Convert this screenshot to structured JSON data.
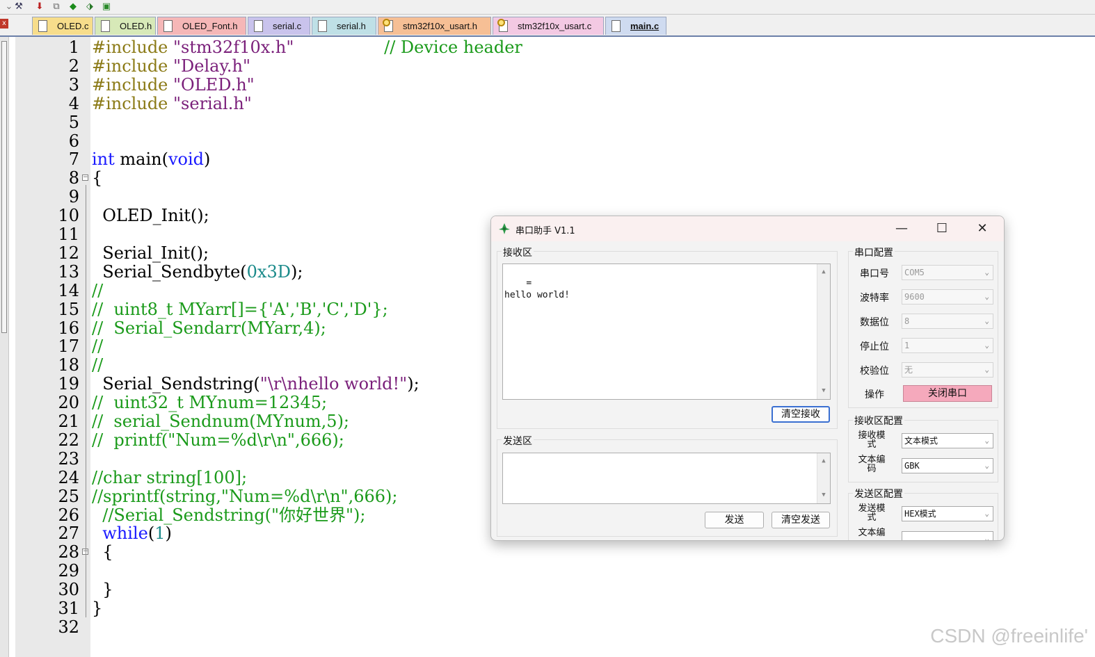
{
  "toolbar": {
    "icons": [
      "tools-icon",
      "load-icon",
      "copy-icon",
      "diamond-icon",
      "pack-icon",
      "green-box-icon"
    ]
  },
  "tabs": [
    {
      "label": "OLED.c",
      "color": "#f7dd8b",
      "icon": "file-icon"
    },
    {
      "label": "OLED.h",
      "color": "#d7e9b8",
      "icon": "file-icon"
    },
    {
      "label": "OLED_Font.h",
      "color": "#f5b7b7",
      "icon": "file-icon"
    },
    {
      "label": "serial.c",
      "color": "#c9c3ec",
      "icon": "file-icon"
    },
    {
      "label": "serial.h",
      "color": "#bfe0e6",
      "icon": "file-icon"
    },
    {
      "label": "stm32f10x_usart.h",
      "color": "#f6bf95",
      "icon": "key-file-icon"
    },
    {
      "label": "stm32f10x_usart.c",
      "color": "#f3c9e3",
      "icon": "key-file-icon"
    },
    {
      "label": "main.c",
      "color": "#cfdbf0",
      "icon": "file-icon",
      "active": true
    }
  ],
  "code_lines": [
    {
      "n": "1",
      "tokens": [
        {
          "t": "#include ",
          "c": "pp"
        },
        {
          "t": "\"stm32f10x.h\"",
          "c": "str"
        },
        {
          "t": "                 ",
          "c": ""
        },
        {
          "t": "// Device header",
          "c": "cmt"
        }
      ]
    },
    {
      "n": "2",
      "tokens": [
        {
          "t": "#include ",
          "c": "pp"
        },
        {
          "t": "\"Delay.h\"",
          "c": "str"
        }
      ]
    },
    {
      "n": "3",
      "tokens": [
        {
          "t": "#include ",
          "c": "pp"
        },
        {
          "t": "\"OLED.h\"",
          "c": "str"
        }
      ]
    },
    {
      "n": "4",
      "tokens": [
        {
          "t": "#include ",
          "c": "pp"
        },
        {
          "t": "\"serial.h\"",
          "c": "str"
        }
      ]
    },
    {
      "n": "5",
      "tokens": []
    },
    {
      "n": "6",
      "tokens": []
    },
    {
      "n": "7",
      "tokens": [
        {
          "t": "int",
          "c": "kw"
        },
        {
          "t": " main(",
          "c": ""
        },
        {
          "t": "void",
          "c": "kw"
        },
        {
          "t": ")",
          "c": ""
        }
      ]
    },
    {
      "n": "8",
      "tokens": [
        {
          "t": "{",
          "c": ""
        }
      ],
      "fold": "open"
    },
    {
      "n": "9",
      "tokens": []
    },
    {
      "n": "10",
      "tokens": [
        {
          "t": "  OLED_Init();",
          "c": ""
        }
      ]
    },
    {
      "n": "11",
      "tokens": []
    },
    {
      "n": "12",
      "tokens": [
        {
          "t": "  Serial_Init();",
          "c": ""
        }
      ]
    },
    {
      "n": "13",
      "tokens": [
        {
          "t": "  Serial_Sendbyte(",
          "c": ""
        },
        {
          "t": "0x3D",
          "c": "num"
        },
        {
          "t": ");",
          "c": ""
        }
      ]
    },
    {
      "n": "14",
      "tokens": [
        {
          "t": "//",
          "c": "cmt"
        }
      ]
    },
    {
      "n": "15",
      "tokens": [
        {
          "t": "//  uint8_t MYarr[]={'A','B','C','D'};",
          "c": "cmt"
        }
      ]
    },
    {
      "n": "16",
      "tokens": [
        {
          "t": "//  Serial_Sendarr(MYarr,4);",
          "c": "cmt"
        }
      ]
    },
    {
      "n": "17",
      "tokens": [
        {
          "t": "//",
          "c": "cmt"
        }
      ]
    },
    {
      "n": "18",
      "tokens": [
        {
          "t": "//",
          "c": "cmt"
        }
      ]
    },
    {
      "n": "19",
      "tokens": [
        {
          "t": "  Serial_Sendstring(",
          "c": ""
        },
        {
          "t": "\"\\r\\nhello world!\"",
          "c": "str"
        },
        {
          "t": ");",
          "c": ""
        }
      ]
    },
    {
      "n": "20",
      "tokens": [
        {
          "t": "//  uint32_t MYnum=12345;",
          "c": "cmt"
        }
      ]
    },
    {
      "n": "21",
      "tokens": [
        {
          "t": "//  serial_Sendnum(MYnum,5);",
          "c": "cmt"
        }
      ]
    },
    {
      "n": "22",
      "tokens": [
        {
          "t": "//  printf(\"Num=%d\\r\\n\",666);",
          "c": "cmt"
        }
      ]
    },
    {
      "n": "23",
      "tokens": []
    },
    {
      "n": "24",
      "tokens": [
        {
          "t": "//char string[100];",
          "c": "cmt"
        }
      ]
    },
    {
      "n": "25",
      "tokens": [
        {
          "t": "//sprintf(string,\"Num=%d\\r\\n\",666);",
          "c": "cmt"
        }
      ]
    },
    {
      "n": "26",
      "tokens": [
        {
          "t": "  //Serial_Sendstring(\"你好世界\");",
          "c": "cmt"
        }
      ]
    },
    {
      "n": "27",
      "tokens": [
        {
          "t": "  ",
          "c": ""
        },
        {
          "t": "while",
          "c": "kw"
        },
        {
          "t": "(",
          "c": ""
        },
        {
          "t": "1",
          "c": "num"
        },
        {
          "t": ")",
          "c": ""
        }
      ]
    },
    {
      "n": "28",
      "tokens": [
        {
          "t": "  {",
          "c": ""
        }
      ],
      "fold": "open"
    },
    {
      "n": "29",
      "tokens": []
    },
    {
      "n": "30",
      "tokens": [
        {
          "t": "  }",
          "c": ""
        }
      ]
    },
    {
      "n": "31",
      "tokens": [
        {
          "t": "}",
          "c": ""
        }
      ]
    },
    {
      "n": "32",
      "tokens": []
    }
  ],
  "watermark": "CSDN @freeinlife'",
  "dialog": {
    "title": "串口助手 V1.1",
    "minimize": "—",
    "maximize": "☐",
    "close": "✕",
    "receive": {
      "title": "接收区",
      "content": "=\nhello world!",
      "clear_button": "清空接收"
    },
    "send": {
      "title": "发送区",
      "content": "",
      "send_button": "发送",
      "clear_button": "清空发送"
    },
    "port_config": {
      "title": "串口配置",
      "port_label": "串口号",
      "port_value": "COM5",
      "baud_label": "波特率",
      "baud_value": "9600",
      "databits_label": "数据位",
      "databits_value": "8",
      "stopbits_label": "停止位",
      "stopbits_value": "1",
      "parity_label": "校验位",
      "parity_value": "无",
      "op_label": "操作",
      "op_button": "关闭串口"
    },
    "receive_config": {
      "title": "接收区配置",
      "mode_label": "接收模式",
      "mode_value": "文本模式",
      "encoding_label": "文本编码",
      "encoding_value": "GBK"
    },
    "send_config": {
      "title": "发送区配置",
      "mode_label": "发送模式",
      "mode_value": "HEX模式",
      "encoding_label": "文本编"
    }
  }
}
